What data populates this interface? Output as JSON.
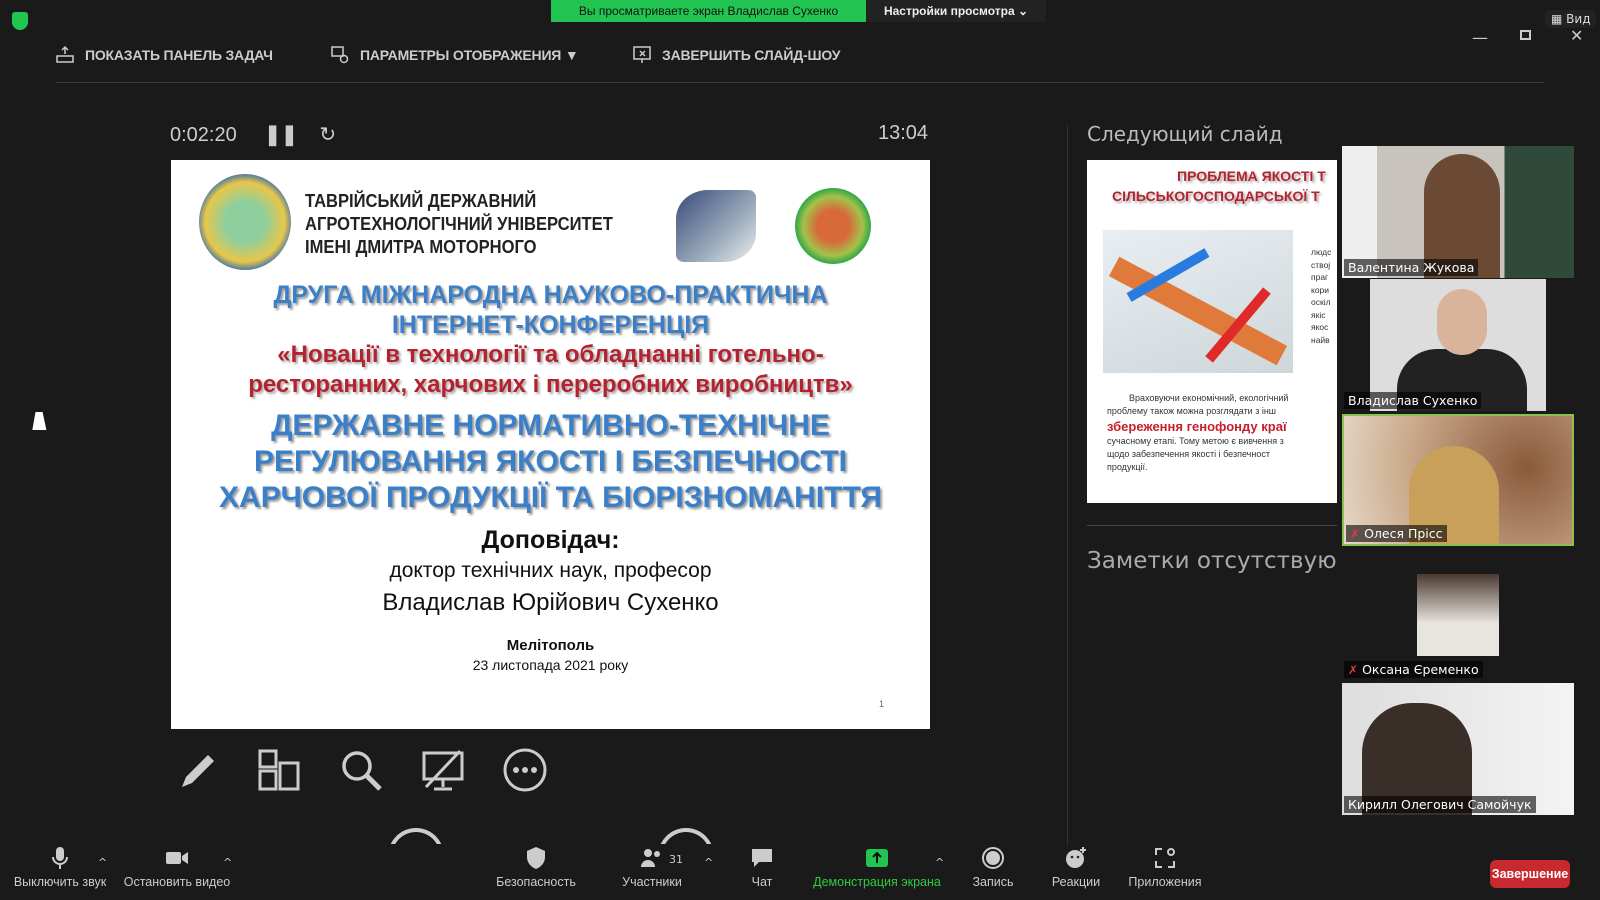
{
  "banner": {
    "viewing": "Вы просматриваете экран Владислав Сухенко",
    "view_settings": "Настройки просмотра ⌄",
    "view_button": "Вид"
  },
  "toolbar": {
    "show_taskbar": "ПОКАЗАТЬ ПАНЕЛЬ ЗАДАЧ",
    "display_settings": "ПАРАМЕТРЫ ОТОБРАЖЕНИЯ ▼",
    "end_slideshow": "ЗАВЕРШИТЬ СЛАЙД-ШОУ"
  },
  "presenter": {
    "elapsed": "0:02:20",
    "clock": "13:04",
    "next_slide_label": "Следующий слайд",
    "notes": "Заметки отсутствуют."
  },
  "slide": {
    "university": [
      "ТАВРІЙСЬКИЙ ДЕРЖАВНИЙ",
      "АГРОТЕХНОЛОГІЧНИЙ УНІВЕРСИТЕТ",
      "ІМЕНІ ДМИТРА МОТОРНОГО"
    ],
    "conf1": "ДРУГА МІЖНАРОДНА НАУКОВО-ПРАКТИЧНА",
    "conf2": "ІНТЕРНЕТ-КОНФЕРЕНЦІЯ",
    "theme1": "«Новації в технології та обладнанні готельно-",
    "theme2": "ресторанних, харчових і переробних виробництв»",
    "title1": "ДЕРЖАВНЕ НОРМАТИВНО-ТЕХНІЧНЕ",
    "title2": "РЕГУЛЮВАННЯ ЯКОСТІ І БЕЗПЕЧНОСТІ",
    "title3": "ХАРЧОВОЇ ПРОДУКЦІЇ ТА БІОРІЗНОМАНІТТЯ",
    "speaker_label": "Доповідач:",
    "speaker_degree": "доктор технічних наук, професор",
    "speaker_name": "Владислав Юрійович Сухенко",
    "city": "Мелітополь",
    "date": "23 листопада 2021 року",
    "page": "1"
  },
  "next_slide": {
    "title1": "ПРОБЛЕМА ЯКОСТІ Т",
    "title2": "СІЛЬСЬКОГОСПОДАРСЬКОЇ Т",
    "side_text": [
      "людс",
      "ствој",
      "праг",
      "кори",
      "оскіл",
      "якіс",
      "якос",
      "найв"
    ],
    "body1": "Враховуючи економічний, екологічний",
    "body2": "проблему також можна розглядати з інш",
    "highlight": "збереження генофонду краї",
    "body3": "сучасному етапі. Тому метою є вивчення з",
    "body4": "щодо забезпечення якості і безпечност",
    "body5": "продукції."
  },
  "participants": [
    {
      "name": "Валентина Жукова",
      "muted": false
    },
    {
      "name": "Владислав Сухенко",
      "muted": false
    },
    {
      "name": "Олеся Прісс",
      "muted": true
    },
    {
      "name": "Оксана Єременко",
      "muted": true
    },
    {
      "name": "Кирилл Олегович Самойчук",
      "muted": false
    }
  ],
  "bottom": {
    "mute": "Выключить звук",
    "video": "Остановить видео",
    "security": "Безопасность",
    "participants": "Участники",
    "participants_count": "31",
    "chat": "Чат",
    "share": "Демонстрация экрана",
    "record": "Запись",
    "reactions": "Реакции",
    "apps": "Приложения",
    "end": "Завершение"
  },
  "colors": {
    "accent_green": "#23c552",
    "end_red": "#c8292f"
  }
}
